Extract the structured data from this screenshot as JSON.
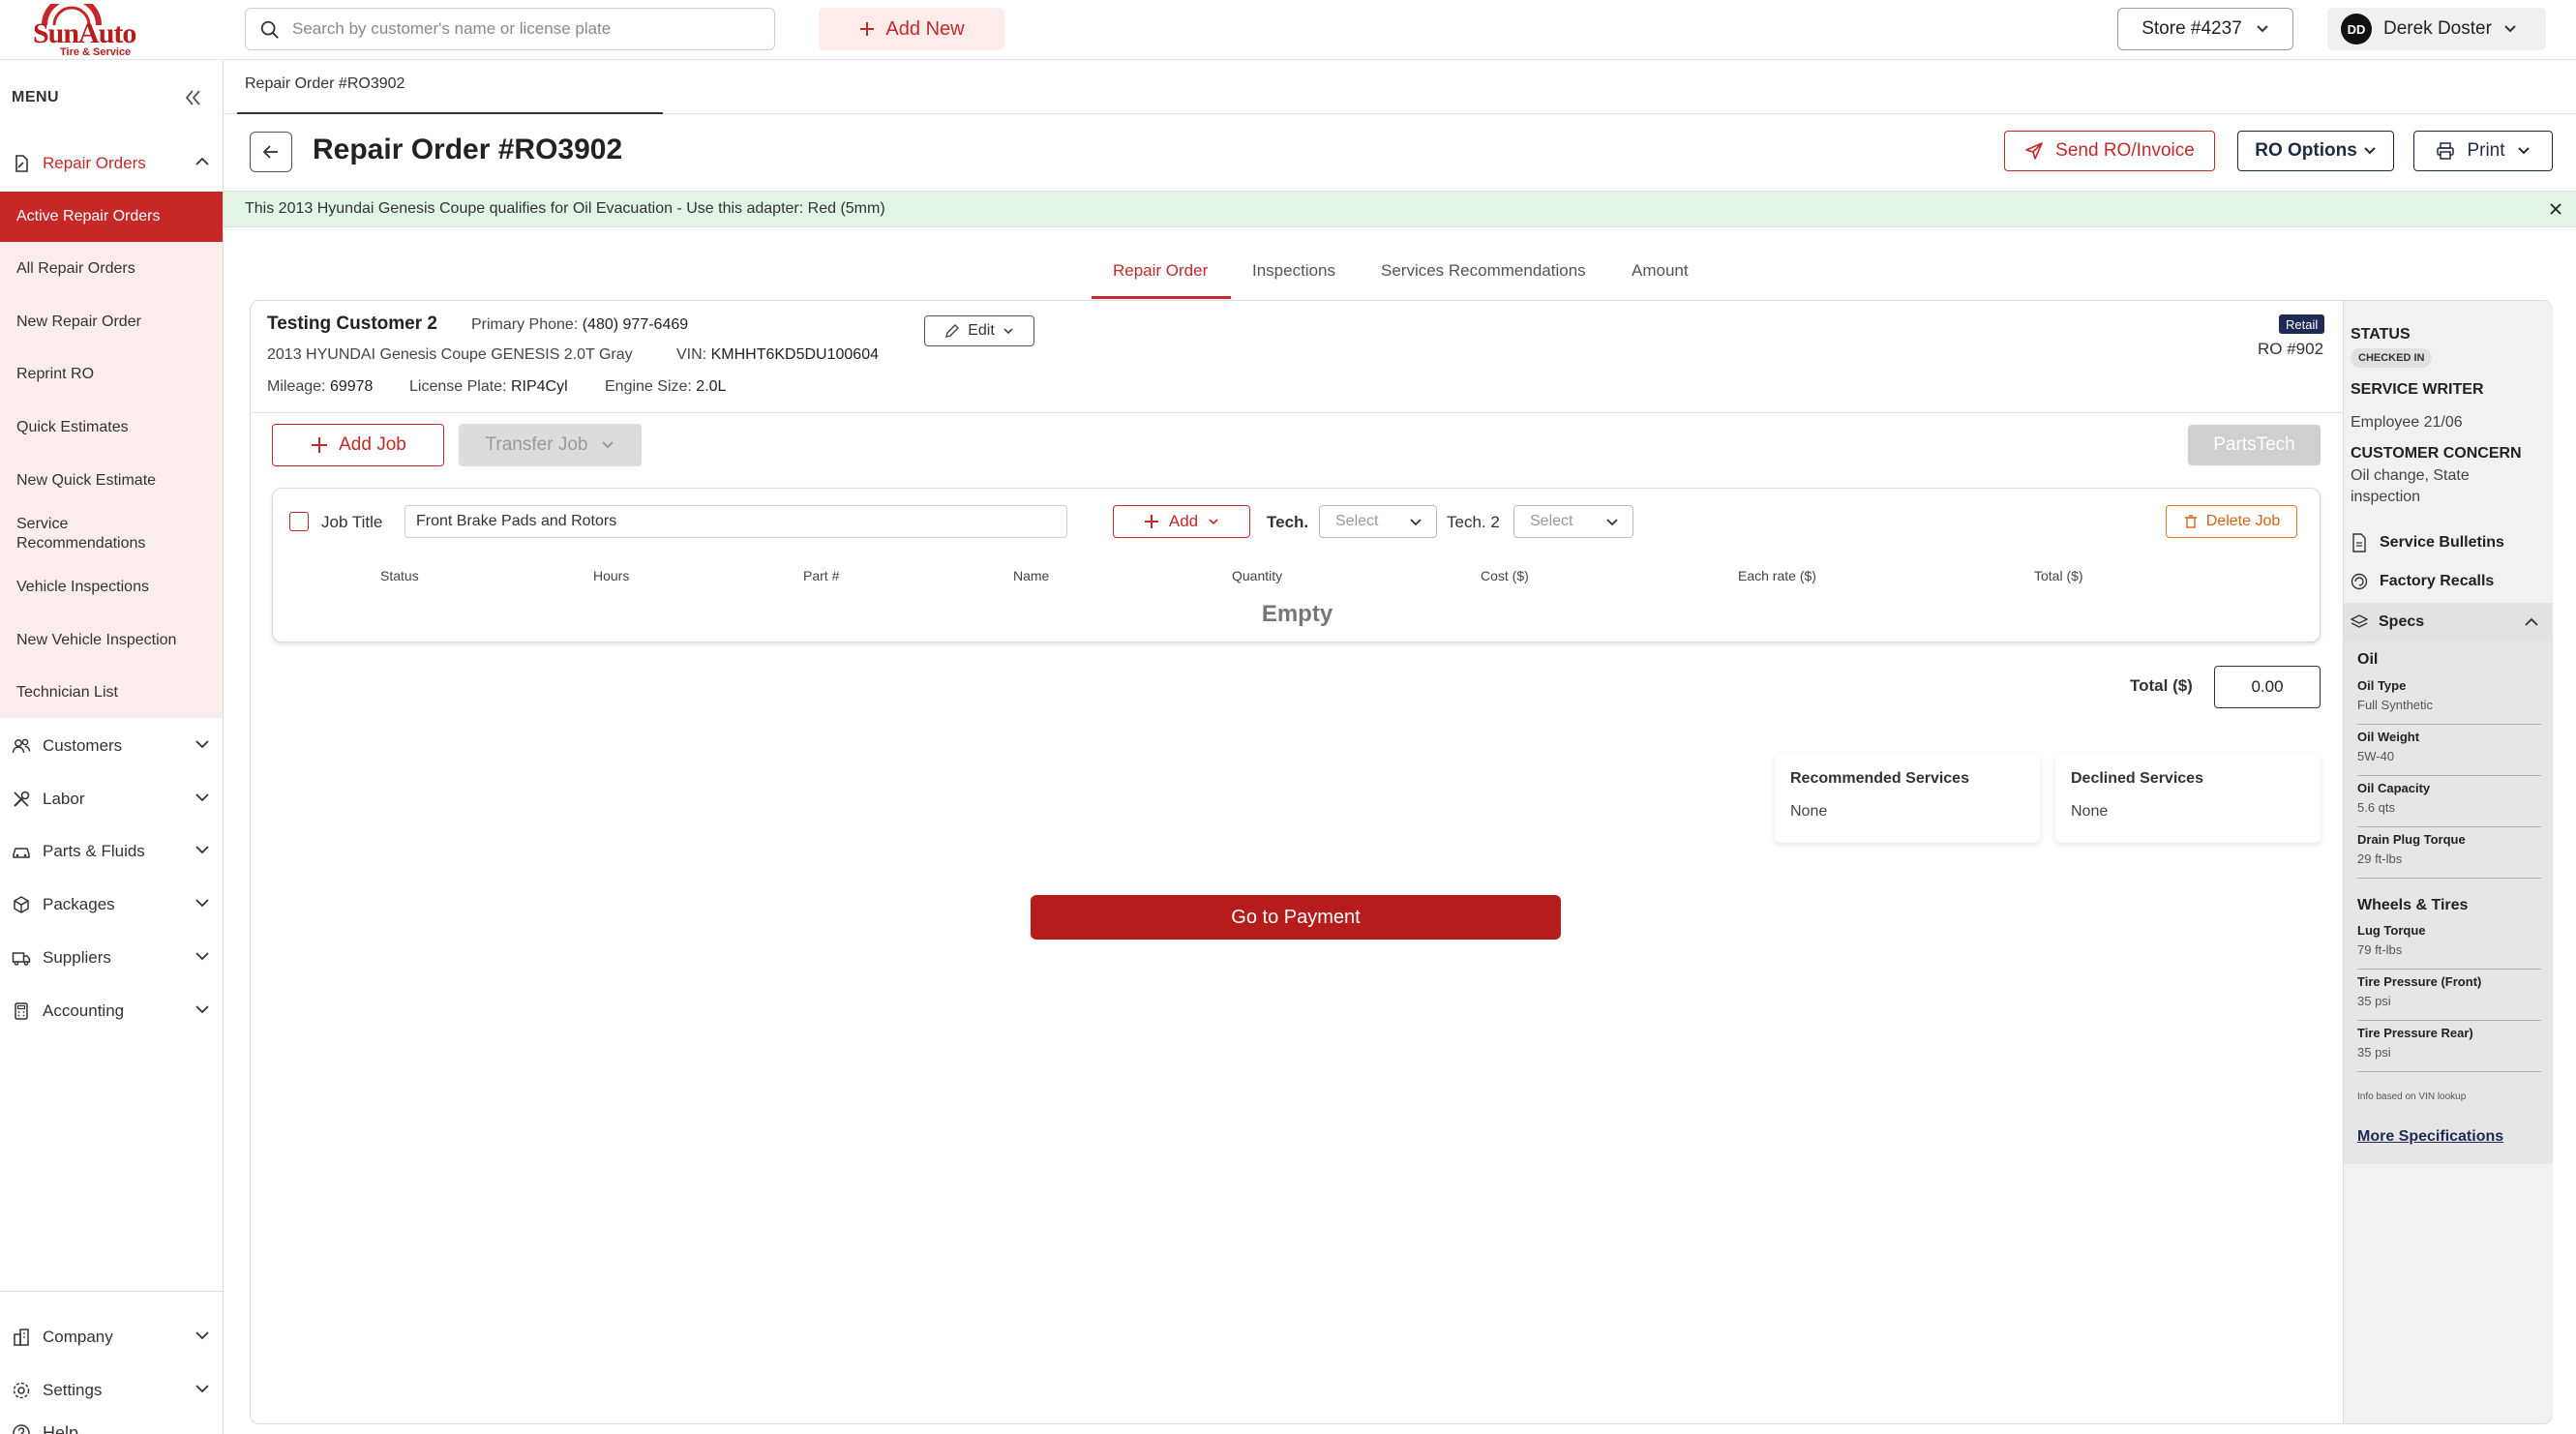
{
  "brand": {
    "name": "SunAuto",
    "tagline": "Tire & Service",
    "accent": "#c62828"
  },
  "header": {
    "search_placeholder": "Search by customer's name or license plate",
    "add_new": "Add New",
    "store": "Store #4237",
    "user_initials": "DD",
    "user_name": "Derek Doster"
  },
  "sidebar": {
    "menu_label": "MENU",
    "sections": {
      "repair_orders": "Repair Orders",
      "customers": "Customers",
      "labor": "Labor",
      "parts": "Parts & Fluids",
      "packages": "Packages",
      "suppliers": "Suppliers",
      "accounting": "Accounting",
      "company": "Company",
      "settings": "Settings",
      "help": "Help"
    },
    "sub_items": [
      "Active Repair Orders",
      "All Repair Orders",
      "New Repair Order",
      "Reprint RO",
      "Quick Estimates",
      "New Quick Estimate",
      "Service Recommendations",
      "Vehicle Inspections",
      "New Vehicle Inspection",
      "Technician List"
    ]
  },
  "breadcrumb": "Repair Order #RO3902",
  "page": {
    "title": "Repair Order #RO3902",
    "send_button": "Send RO/Invoice",
    "options_button": "RO Options",
    "print_button": "Print"
  },
  "notice": "This 2013 Hyundai Genesis Coupe qualifies for Oil Evacuation - Use this adapter: Red (5mm)",
  "tabs": [
    "Repair Order",
    "Inspections",
    "Services Recommendations",
    "Amount"
  ],
  "customer": {
    "name": "Testing Customer 2",
    "phone_label": "Primary Phone:",
    "phone": "(480) 977-6469",
    "vehicle": "2013 HYUNDAI Genesis Coupe GENESIS 2.0T Gray",
    "vin_label": "VIN:",
    "vin": "KMHHT6KD5DU100604",
    "mileage_label": "Mileage:",
    "mileage": "69978",
    "plate_label": "License Plate:",
    "plate": "RIP4Cyl",
    "engine_label": "Engine Size:",
    "engine": "2.0L",
    "edit": "Edit",
    "badge": "Retail",
    "ro_number": "RO #902"
  },
  "actions": {
    "add_job": "Add Job",
    "transfer_job": "Transfer Job",
    "partstech": "PartsTech"
  },
  "job": {
    "title_label": "Job Title",
    "title_value": "Front Brake Pads and Rotors",
    "add": "Add",
    "tech_label": "Tech.",
    "tech_value": "Select",
    "tech2_label": "Tech. 2",
    "tech2_value": "Select",
    "delete": "Delete Job",
    "columns": [
      "Status",
      "Hours",
      "Part #",
      "Name",
      "Quantity",
      "Cost ($)",
      "Each rate ($)",
      "Total ($)"
    ],
    "empty": "Empty"
  },
  "totals": {
    "label": "Total ($)",
    "value": "0.00"
  },
  "services": {
    "recommended_label": "Recommended Services",
    "recommended_value": "None",
    "declined_label": "Declined Services",
    "declined_value": "None"
  },
  "payment_button": "Go to Payment",
  "right_panel": {
    "status_label": "STATUS",
    "status_value": "CHECKED IN",
    "writer_label": "SERVICE WRITER",
    "writer_value": "Employee 21/06",
    "concern_label": "CUSTOMER CONCERN",
    "concern_value": "Oil change, State inspection",
    "bulletins": "Service Bulletins",
    "recalls": "Factory Recalls",
    "specs_label": "Specs",
    "oil_group": "Oil",
    "oil_specs": [
      {
        "k": "Oil Type",
        "v": "Full Synthetic"
      },
      {
        "k": "Oil Weight",
        "v": "5W-40"
      },
      {
        "k": "Oil Capacity",
        "v": "5.6 qts"
      },
      {
        "k": "Drain Plug Torque",
        "v": "29 ft-lbs"
      }
    ],
    "wheels_group": "Wheels & Tires",
    "wheel_specs": [
      {
        "k": "Lug Torque",
        "v": "79 ft-lbs"
      },
      {
        "k": "Tire Pressure (Front)",
        "v": "35 psi"
      },
      {
        "k": "Tire Pressure Rear)",
        "v": "35 psi"
      }
    ],
    "vin_note": "Info based on VIN lookup",
    "more_specs": "More Specifications"
  }
}
